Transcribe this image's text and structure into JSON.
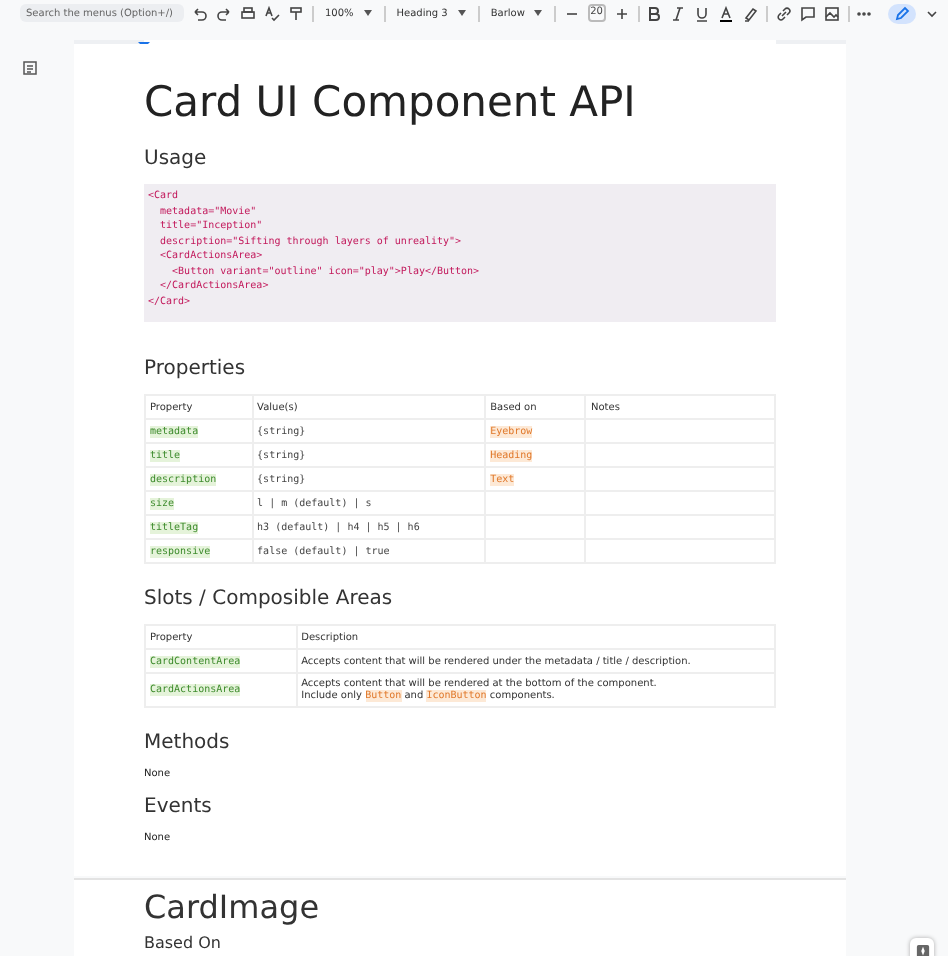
{
  "toolbar": {
    "search": {
      "placeholder": "Search the menus (Option+/)"
    },
    "zoom": "100%",
    "style": "Heading 3",
    "font": "Barlow",
    "font_size": "20"
  },
  "document": {
    "pages": [
      {
        "blocks": [
          {
            "kind": "title",
            "text": "Card UI Component API"
          },
          {
            "kind": "heading",
            "text": "Usage"
          },
          {
            "kind": "code",
            "lines": [
              "<Card",
              "  metadata=\"Movie\"",
              "  title=\"Inception\"",
              "  description=\"Sifting through layers of unreality\">",
              "  <CardActionsArea>",
              "    <Button variant=\"outline\" icon=\"play\">Play</Button>",
              "  </CardActionsArea>",
              "</Card>"
            ]
          },
          {
            "kind": "heading",
            "text": "Properties"
          },
          {
            "kind": "table",
            "header": [
              "Property",
              "Value(s)",
              "Based on",
              "Notes"
            ],
            "rows": [
              [
                {
                  "kind": "code",
                  "text": "metadata"
                },
                {
                  "kind": "mono",
                  "text": "{string}"
                },
                {
                  "kind": "ref",
                  "text": "Eyebrow"
                },
                {
                  "kind": "plain",
                  "text": ""
                }
              ],
              [
                {
                  "kind": "code",
                  "text": "title"
                },
                {
                  "kind": "mono",
                  "text": "{string}"
                },
                {
                  "kind": "ref",
                  "text": "Heading"
                },
                {
                  "kind": "plain",
                  "text": ""
                }
              ],
              [
                {
                  "kind": "code",
                  "text": "description"
                },
                {
                  "kind": "mono",
                  "text": "{string}"
                },
                {
                  "kind": "ref",
                  "text": "Text"
                },
                {
                  "kind": "plain",
                  "text": ""
                }
              ],
              [
                {
                  "kind": "code",
                  "text": "size"
                },
                {
                  "kind": "mono",
                  "text": "l | m (default) | s"
                },
                {
                  "kind": "plain",
                  "text": ""
                },
                {
                  "kind": "plain",
                  "text": ""
                }
              ],
              [
                {
                  "kind": "code",
                  "text": "titleTag"
                },
                {
                  "kind": "mono",
                  "text": "h3 (default) | h4 | h5 | h6"
                },
                {
                  "kind": "plain",
                  "text": ""
                },
                {
                  "kind": "plain",
                  "text": ""
                }
              ],
              [
                {
                  "kind": "code",
                  "text": "responsive"
                },
                {
                  "kind": "mono",
                  "text": "false (default) | true"
                },
                {
                  "kind": "plain",
                  "text": ""
                },
                {
                  "kind": "plain",
                  "text": ""
                }
              ]
            ]
          },
          {
            "kind": "heading",
            "text": "Slots / Composible Areas"
          },
          {
            "kind": "table",
            "header": [
              "Property",
              "Description"
            ],
            "rows": [
              [
                {
                  "kind": "code",
                  "text": "CardContentArea"
                },
                {
                  "kind": "plain",
                  "text": "Accepts content that will be rendered under the metadata / title / description."
                }
              ],
              [
                {
                  "kind": "code",
                  "text": "CardActionsArea"
                },
                {
                  "kind": "runs",
                  "lines": [
                    [
                      {
                        "kind": "plain",
                        "text": "Accepts content that will be rendered at the bottom of the component."
                      }
                    ],
                    [
                      {
                        "kind": "plain",
                        "text": "Include only "
                      },
                      {
                        "kind": "ref",
                        "text": "Button"
                      },
                      {
                        "kind": "plain",
                        "text": " and "
                      },
                      {
                        "kind": "ref",
                        "text": "IconButton"
                      },
                      {
                        "kind": "plain",
                        "text": " components."
                      }
                    ]
                  ]
                }
              ]
            ]
          },
          {
            "kind": "heading",
            "text": "Methods"
          },
          {
            "kind": "paragraph",
            "text": "None"
          },
          {
            "kind": "heading",
            "text": "Events"
          },
          {
            "kind": "paragraph",
            "text": "None"
          }
        ]
      },
      {
        "blocks": [
          {
            "kind": "heading2",
            "text": "CardImage"
          },
          {
            "kind": "subheading",
            "text": "Based On"
          }
        ]
      }
    ]
  }
}
